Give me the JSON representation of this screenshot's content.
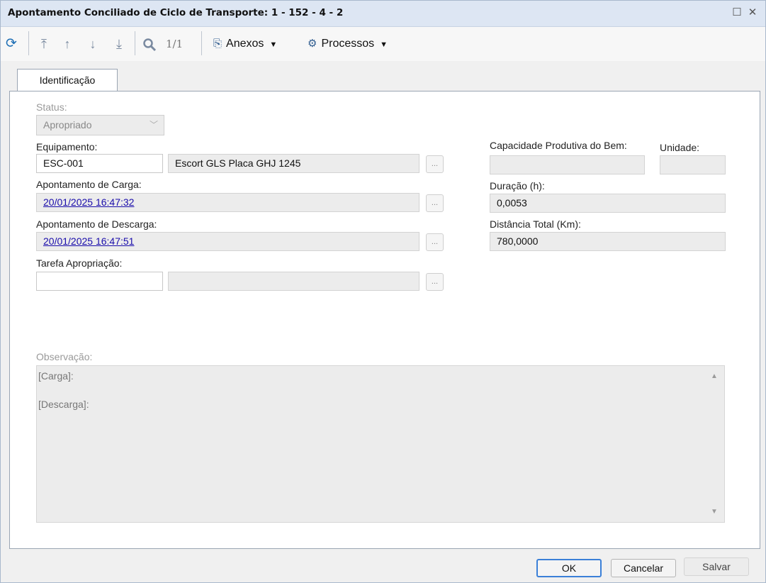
{
  "window": {
    "title": "Apontamento Conciliado de Ciclo de Transporte: 1 - 152 - 4 - 2",
    "maximize_icon": "square-icon",
    "close_icon": "x-icon"
  },
  "toolbar": {
    "refresh_icon": "refresh-icon",
    "first_icon": "first-record-icon",
    "prev_icon": "previous-record-icon",
    "next_icon": "next-record-icon",
    "last_icon": "last-record-icon",
    "search_icon": "search-icon",
    "pager": "1/1",
    "attachments_label": "Anexos",
    "processes_label": "Processos"
  },
  "tabs": [
    {
      "label": "Identificação"
    }
  ],
  "form": {
    "status_label": "Status:",
    "status_value": "Apropriado",
    "equipamento_label": "Equipamento:",
    "equipamento_code": "ESC-001",
    "equipamento_desc": "Escort GLS Placa GHJ 1245",
    "carga_label": "Apontamento de Carga:",
    "carga_value": "20/01/2025 16:47:32",
    "descarga_label": "Apontamento de Descarga:",
    "descarga_value": "20/01/2025 16:47:51",
    "tarefa_label": "Tarefa Apropriação:",
    "tarefa_code": "",
    "tarefa_desc": "",
    "capacidade_label": "Capacidade Produtiva do Bem:",
    "capacidade_value": "",
    "unidade_label": "Unidade:",
    "unidade_value": "",
    "duracao_label": "Duração (h):",
    "duracao_value": "0,0053",
    "distancia_label": "Distância Total (Km):",
    "distancia_value": "780,0000",
    "lookup_label": "...",
    "observacao_label": "Observação:",
    "observacao_lines": [
      "[Carga]:",
      "[Descarga]:"
    ]
  },
  "buttons": {
    "ok": "OK",
    "cancel": "Cancelar",
    "save": "Salvar"
  }
}
